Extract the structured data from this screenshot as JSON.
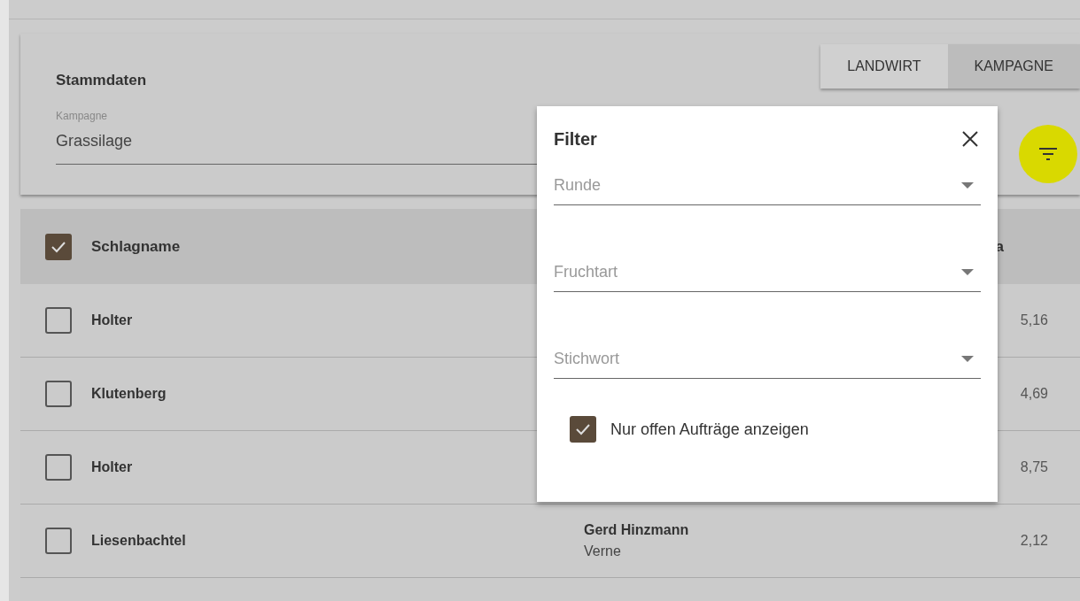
{
  "card": {
    "title": "Stammdaten",
    "field": {
      "label": "Kampagne",
      "value": "Grassilage"
    }
  },
  "tabs": [
    {
      "label": "LANDWIRT",
      "selected": false
    },
    {
      "label": "KAMPAGNE",
      "selected": true
    }
  ],
  "table": {
    "header": {
      "checked": true,
      "label": "Schlagname",
      "column_3": "a"
    },
    "rows": [
      {
        "name": "Holter",
        "checked": false,
        "farmer": "",
        "place": "",
        "value": "5,16"
      },
      {
        "name": "Klutenberg",
        "checked": false,
        "farmer": "",
        "place": "",
        "value": "4,69"
      },
      {
        "name": "Holter",
        "checked": false,
        "farmer": "",
        "place": "",
        "value": "8,75"
      },
      {
        "name": "Liesenbachtel",
        "checked": false,
        "farmer": "Gerd Hinzmann",
        "place": "Verne",
        "value": "2,12"
      }
    ]
  },
  "filter": {
    "title": "Filter",
    "selects": [
      {
        "placeholder": "Runde"
      },
      {
        "placeholder": "Fruchtart"
      },
      {
        "placeholder": "Stichwort"
      }
    ],
    "option": {
      "label": "Nur offen Aufträge anzeigen",
      "checked": true
    }
  }
}
